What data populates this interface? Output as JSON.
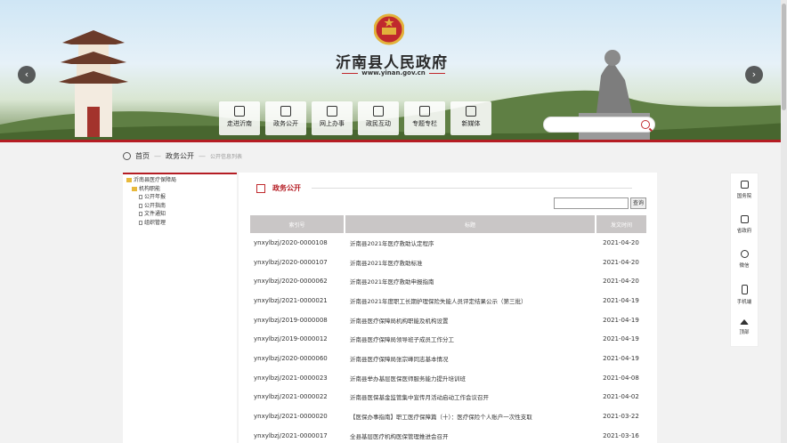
{
  "header": {
    "site_title": "沂南县人民政府",
    "site_url": "www.yinan.gov.cn",
    "prev_arrow": "‹",
    "next_arrow": "›",
    "nav": [
      {
        "label": "走进沂南",
        "icon": "camera-icon"
      },
      {
        "label": "政务公开",
        "icon": "document-icon"
      },
      {
        "label": "网上办事",
        "icon": "form-icon"
      },
      {
        "label": "政民互动",
        "icon": "chat-icon"
      },
      {
        "label": "专题专栏",
        "icon": "book-icon"
      },
      {
        "label": "新媒体",
        "icon": "qrcode-icon"
      }
    ],
    "search_placeholder": ""
  },
  "breadcrumb": {
    "home": "首页",
    "sep1": "—",
    "level1": "政务公开",
    "sep2": "—",
    "current": "公开信息列表"
  },
  "tree": {
    "root": "沂南县医疗保障局",
    "group": "机构职能",
    "items": [
      "公开年报",
      "公开指南",
      "文件通知",
      "组织管理"
    ]
  },
  "panel": {
    "title": "政务公开",
    "search_button": "查询",
    "columns": [
      "索引号",
      "标题",
      "发文时间"
    ],
    "rows": [
      {
        "index": "ynxylbzj/2020-0000108",
        "title": "沂南县2021年医疗救助认定程序",
        "date": "2021-04-20"
      },
      {
        "index": "ynxylbzj/2020-0000107",
        "title": "沂南县2021年医疗救助标准",
        "date": "2021-04-20"
      },
      {
        "index": "ynxylbzj/2020-0000062",
        "title": "沂南县2021年医疗救助申报指南",
        "date": "2021-04-20"
      },
      {
        "index": "ynxylbzj/2021-0000021",
        "title": "沂南县2021年度职工长期护理保险失能人员评定结果公示（第三批）",
        "date": "2021-04-19"
      },
      {
        "index": "ynxylbzj/2019-0000008",
        "title": "沂南县医疗保障局机构职能及机构设置",
        "date": "2021-04-19"
      },
      {
        "index": "ynxylbzj/2019-0000012",
        "title": "沂南县医疗保障局领导班子成员工作分工",
        "date": "2021-04-19"
      },
      {
        "index": "ynxylbzj/2020-0000060",
        "title": "沂南县医疗保障局张宗峰同志基本情况",
        "date": "2021-04-19"
      },
      {
        "index": "ynxylbzj/2021-0000023",
        "title": "沂南县举办基层医保医师服务能力提升培训班",
        "date": "2021-04-08"
      },
      {
        "index": "ynxylbzj/2021-0000022",
        "title": "沂南县医保基金监管集中宣传月活动启动工作会议召开",
        "date": "2021-04-02"
      },
      {
        "index": "ynxylbzj/2021-0000020",
        "title": "【医保办事指南】职工医疗保障篇（十）：医疗保险个人账户一次性支取",
        "date": "2021-03-22"
      },
      {
        "index": "ynxylbzj/2021-0000017",
        "title": "全县基层医疗机构医保管理推进会召开",
        "date": "2021-03-16"
      }
    ]
  },
  "float_bar": [
    {
      "label": "国务院",
      "icon": "building-icon"
    },
    {
      "label": "省政府",
      "icon": "government-icon"
    },
    {
      "label": "微信",
      "icon": "wechat-icon"
    },
    {
      "label": "手机端",
      "icon": "phone-icon"
    },
    {
      "label": "顶部",
      "icon": "up-arrow-icon"
    }
  ],
  "colors": {
    "accent": "#b51d24",
    "table_header": "#c9c6c6"
  }
}
